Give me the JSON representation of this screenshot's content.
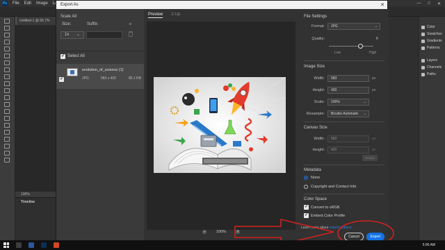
{
  "ps": {
    "menu": [
      "File",
      "Edit",
      "Image",
      "Layer"
    ],
    "doc_tab": "Untitled-1 @ 66.7%",
    "status_zoom": "100%",
    "timeline_label": "Timeline",
    "panels": [
      "Color",
      "Swatches",
      "Gradients",
      "Patterns",
      "Layers",
      "Channels",
      "Paths"
    ]
  },
  "dialog": {
    "title": "Export As",
    "left": {
      "scale_all": "Scale All",
      "size_label": "Size:",
      "suffix_label": "Suffix:",
      "size_value": "1x",
      "select_all": "Select All",
      "file": {
        "name": "evolution_of_science (1)",
        "format": "JPG",
        "dimensions": "583 x 420",
        "filesize": "85.1 KB"
      }
    },
    "center": {
      "tab_preview": "Preview",
      "tab_2up": "2-Up",
      "zoom": "100%"
    },
    "right": {
      "file_settings": {
        "title": "File Settings",
        "format_label": "Format:",
        "format_value": "JPG",
        "quality_label": "Quality:",
        "quality_value": "6",
        "quality_level": 0.6,
        "low": "Low",
        "high": "High"
      },
      "image_size": {
        "title": "Image Size",
        "width_label": "Width:",
        "width_value": "583",
        "height_label": "Height:",
        "height_value": "420",
        "scale_label": "Scale:",
        "scale_value": "100%",
        "resample_label": "Resample:",
        "resample_value": "Bicubic Automatic",
        "unit": "px"
      },
      "canvas_size": {
        "title": "Canvas Size",
        "width_label": "Width:",
        "width_value": "583",
        "height_label": "Height:",
        "height_value": "420",
        "unit": "px",
        "resize_label": "Resize"
      },
      "metadata": {
        "title": "Metadata",
        "option_none": "None",
        "option_copyright": "Copyright and Contact Info"
      },
      "color_space": {
        "title": "Color Space",
        "convert": "Convert to sRGB",
        "embed": "Embed Color Profile"
      },
      "learn_prefix": "Learn more about ",
      "learn_link": "export options",
      "cancel": "Cancel",
      "export": "Export"
    }
  },
  "taskbar": {
    "time": "5:06 AM"
  },
  "colors": {
    "accent": "#1473e6",
    "annotation": "#d32020"
  }
}
